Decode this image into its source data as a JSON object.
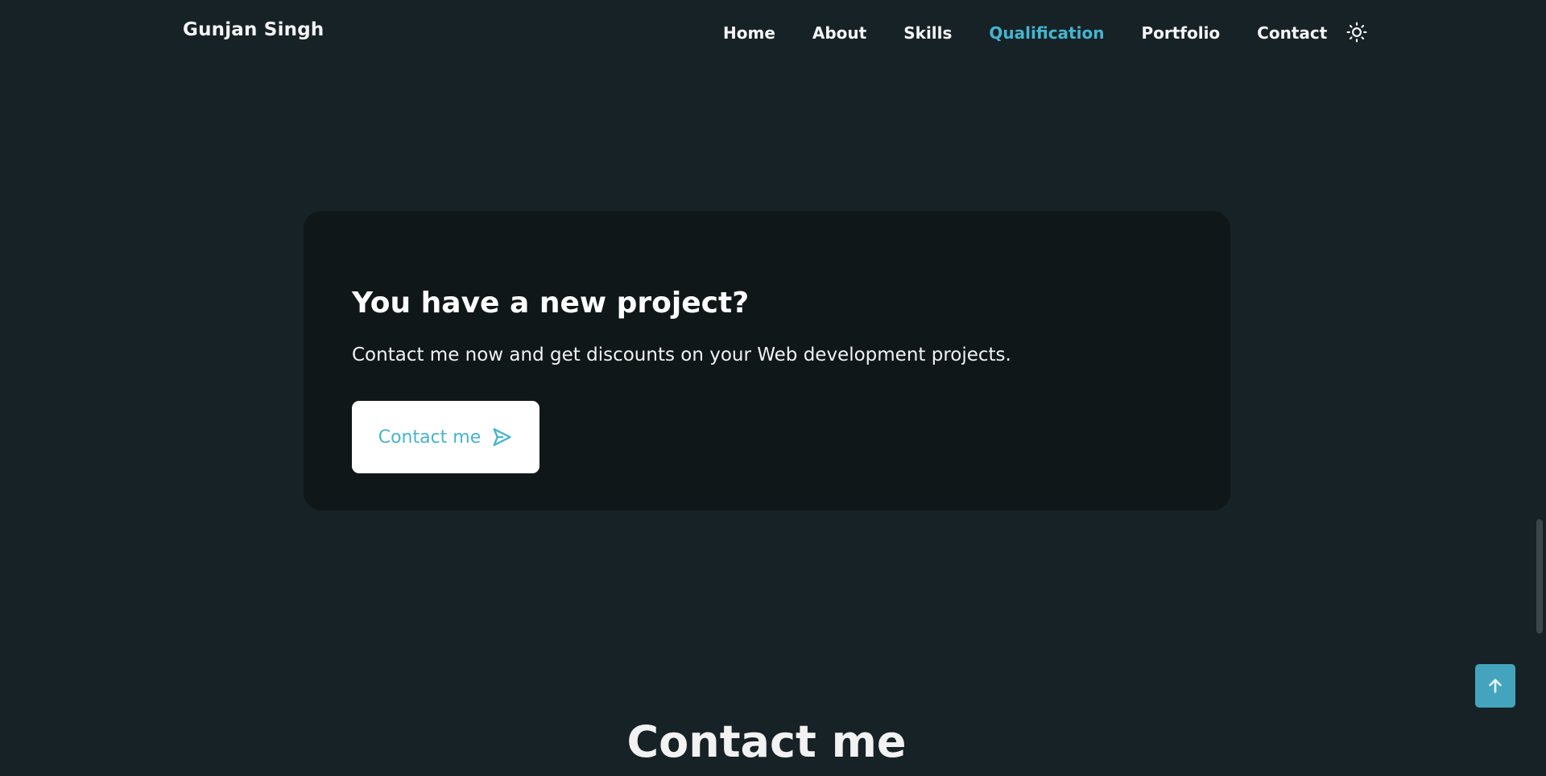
{
  "header": {
    "logo": "Gunjan Singh",
    "nav": [
      {
        "label": "Home"
      },
      {
        "label": "About"
      },
      {
        "label": "Skills"
      },
      {
        "label": "Qualification",
        "active": true
      },
      {
        "label": "Portfolio"
      },
      {
        "label": "Contact"
      }
    ],
    "theme_toggle_icon": "sun-icon"
  },
  "project_card": {
    "title": "You have a new project?",
    "description": "Contact me now and get discounts on your Web development projects.",
    "button_label": "Contact me",
    "button_icon": "send-icon"
  },
  "contact_section": {
    "title": "Contact me"
  },
  "scroll_up_icon": "arrow-up-icon",
  "colors": {
    "background": "#172226",
    "card_background": "#101719",
    "accent": "#45b5cf",
    "scroll_up_background": "#45a4bd",
    "text": "#ffffff"
  }
}
